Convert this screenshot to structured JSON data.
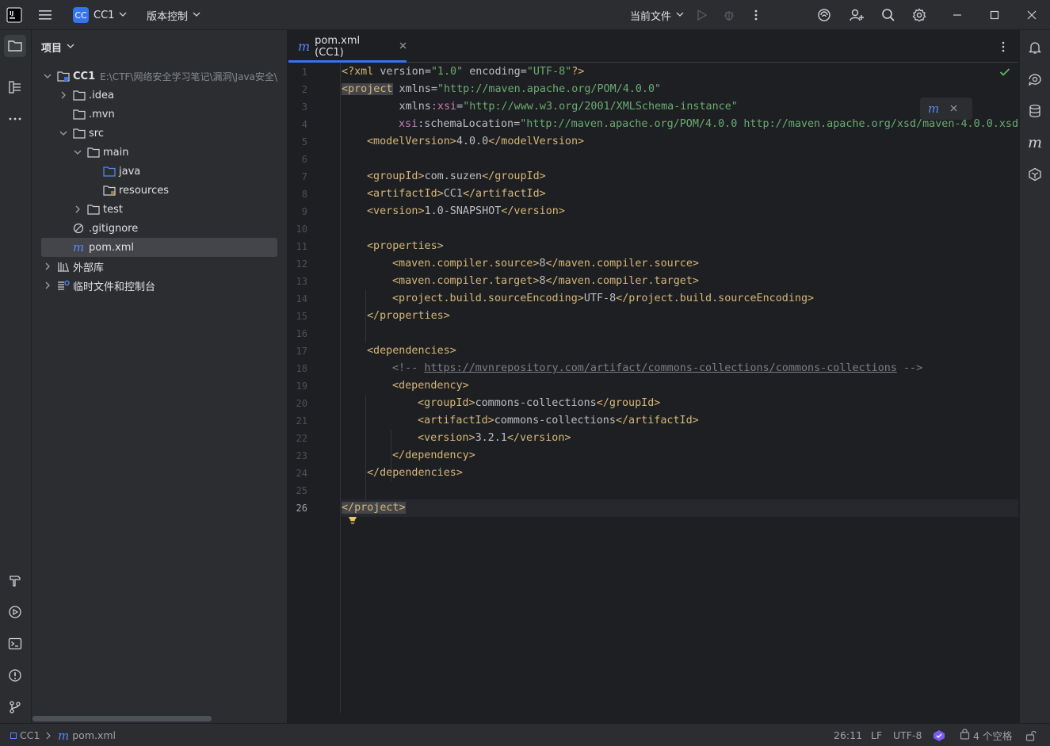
{
  "titlebar": {
    "project_badge": "CC",
    "project_name": "CC1",
    "vcs_label": "版本控制",
    "run_config": "当前文件"
  },
  "project_panel": {
    "title": "项目",
    "tree": [
      {
        "label": "CC1",
        "path": "E:\\CTF\\网络安全学习笔记\\漏洞\\Java安全\\Jav",
        "kind": "module"
      },
      {
        "label": ".idea",
        "kind": "folder"
      },
      {
        "label": ".mvn",
        "kind": "folder"
      },
      {
        "label": "src",
        "kind": "folder"
      },
      {
        "label": "main",
        "kind": "folder"
      },
      {
        "label": "java",
        "kind": "source-folder"
      },
      {
        "label": "resources",
        "kind": "resource-folder"
      },
      {
        "label": "test",
        "kind": "folder"
      },
      {
        "label": ".gitignore",
        "kind": "ignore-file"
      },
      {
        "label": "pom.xml",
        "kind": "maven-file"
      },
      {
        "label": "外部库",
        "kind": "library"
      },
      {
        "label": "临时文件和控制台",
        "kind": "scratches"
      }
    ]
  },
  "editor": {
    "tab_label": "pom.xml (CC1)",
    "line_numbers": [
      "1",
      "2",
      "3",
      "4",
      "5",
      "6",
      "7",
      "8",
      "9",
      "10",
      "11",
      "12",
      "13",
      "14",
      "15",
      "16",
      "17",
      "18",
      "19",
      "20",
      "21",
      "22",
      "23",
      "24",
      "25",
      "26"
    ],
    "current_line": "26",
    "code": {
      "l1_a": "<?xml ",
      "l1_b": "version",
      "l1_c": "=",
      "l1_d": "\"1.0\"",
      "l1_e": " encoding",
      "l1_f": "=",
      "l1_g": "\"UTF-8\"",
      "l1_h": "?>",
      "l2_a": "<project",
      "l2_b": " xmlns",
      "l2_c": "=",
      "l2_d": "\"http://maven.apache.org/POM/4.0.0\"",
      "l3_a": "         xmlns",
      "l3_b": ":xsi",
      "l3_c": "=",
      "l3_d": "\"http://www.w3.org/2001/XMLSchema-instance\"",
      "l4_a": "xsi",
      "l4_b": ":schemaLocation",
      "l4_c": "=",
      "l4_d": "\"http://maven.apache.org/POM/4.0.0 http://maven.apache.org/xsd/maven-4.0.0.xsd\"",
      "l5_a": "<modelVersion>",
      "l5_b": "4.0.0",
      "l5_c": "</modelVersion>",
      "l7_a": "<groupId>",
      "l7_b": "com.suzen",
      "l7_c": "</groupId>",
      "l8_a": "<artifactId>",
      "l8_b": "CC1",
      "l8_c": "</artifactId>",
      "l9_a": "<version>",
      "l9_b": "1.0-SNAPSHOT",
      "l9_c": "</version>",
      "l11": "<properties>",
      "l12_a": "<maven.compiler.source>",
      "l12_b": "8",
      "l12_c": "</maven.compiler.source>",
      "l13_a": "<maven.compiler.target>",
      "l13_b": "8",
      "l13_c": "</maven.compiler.target>",
      "l14_a": "<project.build.sourceEncoding>",
      "l14_b": "UTF-8",
      "l14_c": "</project.build.sourceEncoding>",
      "l15": "</properties>",
      "l17": "<dependencies>",
      "l18_a": "<!-- ",
      "l18_b": "https://mvnrepository.com/artifact/commons-collections/commons-collections",
      "l18_c": " -->",
      "l19": "<dependency>",
      "l20_a": "<groupId>",
      "l20_b": "commons-collections",
      "l20_c": "</groupId>",
      "l21_a": "<artifactId>",
      "l21_b": "commons-collections",
      "l21_c": "</artifactId>",
      "l22_a": "<version>",
      "l22_b": "3.2.1",
      "l22_c": "</version>",
      "l23": "</dependency>",
      "l24": "</dependencies>",
      "l26": "</project>"
    }
  },
  "statusbar": {
    "breadcrumb_project": "CC1",
    "breadcrumb_file": "pom.xml",
    "caret_position": "26:11",
    "line_separator": "LF",
    "encoding": "UTF-8",
    "indent": "4 个空格"
  },
  "colors": {
    "accent": "#3574f0",
    "tag": "#d5b778",
    "string": "#6aab73",
    "namespace": "#c77dbb",
    "comment": "#7a7e85"
  }
}
